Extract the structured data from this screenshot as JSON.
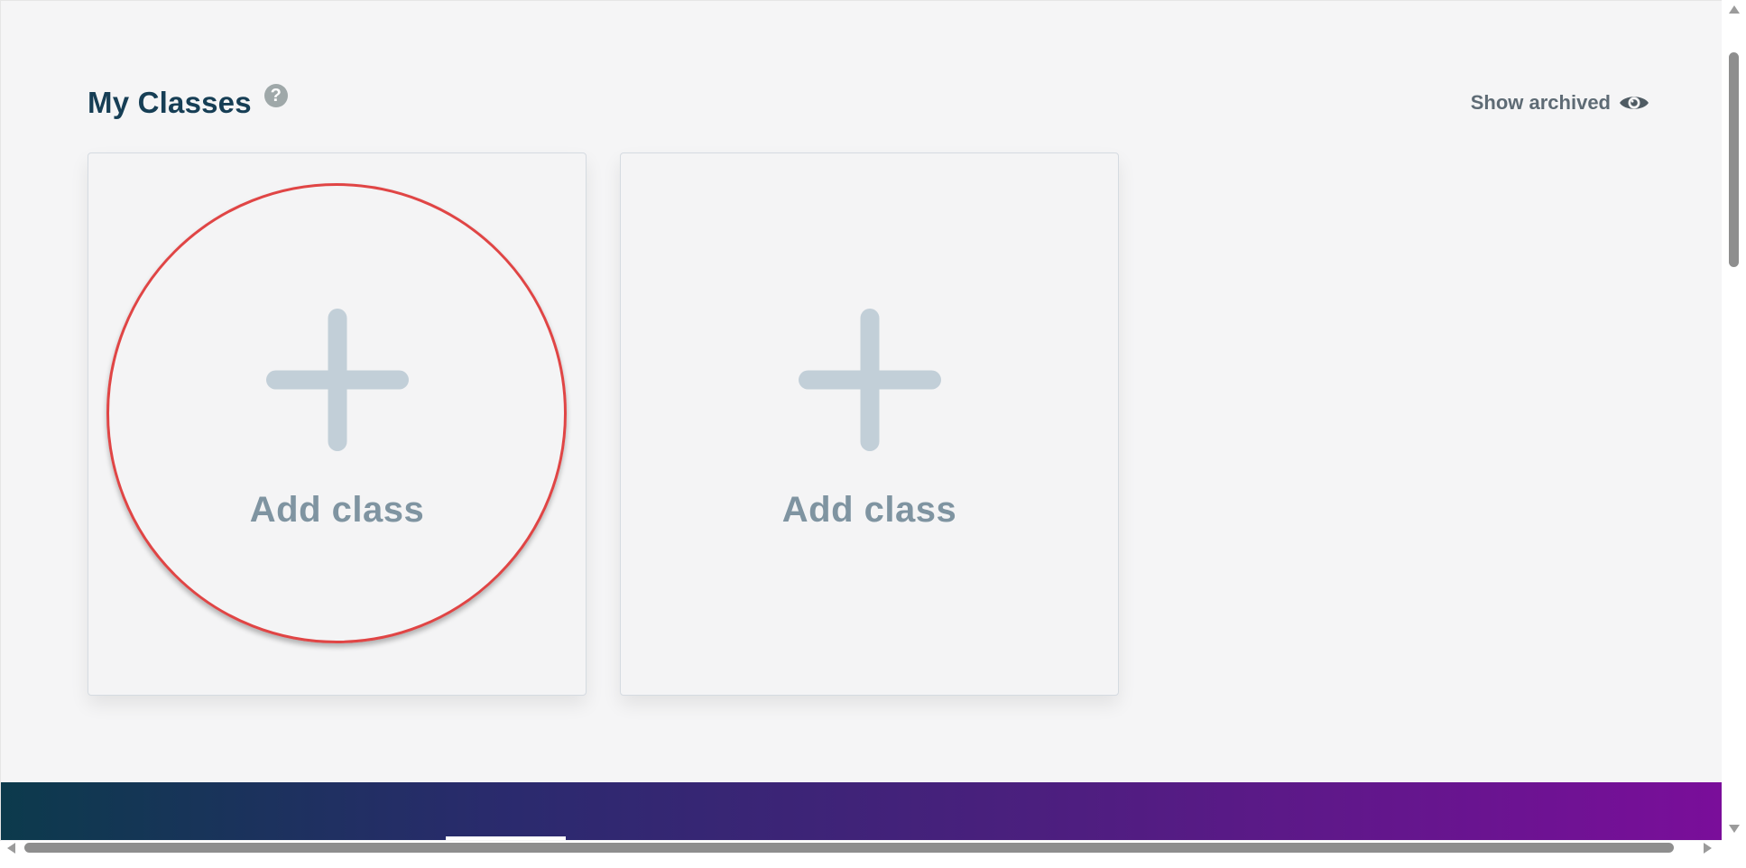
{
  "page": {
    "title": "My Classes",
    "help_icon": "question-circle-icon",
    "show_archived_label": "Show archived",
    "show_archived_icon": "eye-icon"
  },
  "cards": [
    {
      "label": "Add class",
      "icon": "plus-icon",
      "highlighted": true
    },
    {
      "label": "Add class",
      "icon": "plus-icon",
      "highlighted": false
    }
  ],
  "colors": {
    "title": "#163e55",
    "plus": "#c2cfd8",
    "add_label": "#7f94a1",
    "highlight_ring": "#e04545",
    "footer_gradient_start": "#0c3a4c",
    "footer_gradient_end": "#7a0e9a"
  }
}
